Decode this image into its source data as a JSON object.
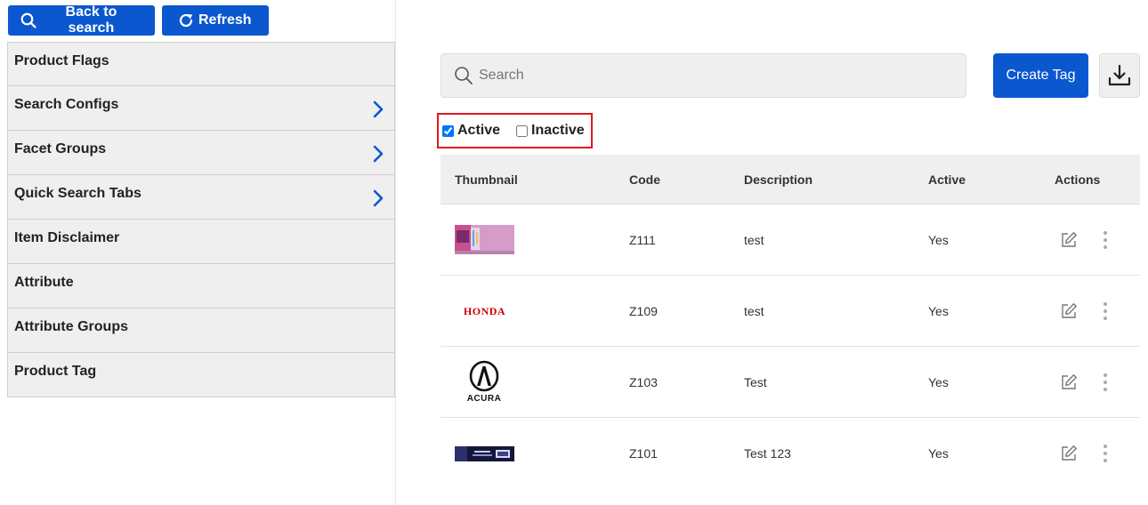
{
  "nav": {
    "back_label": "Back to search",
    "refresh_label": "Refresh"
  },
  "sidebar": {
    "items": [
      {
        "label": "Product Flags",
        "has_chevron": false
      },
      {
        "label": "Search Configs",
        "has_chevron": true
      },
      {
        "label": "Facet Groups",
        "has_chevron": true
      },
      {
        "label": "Quick Search Tabs",
        "has_chevron": true
      },
      {
        "label": "Item Disclaimer",
        "has_chevron": false
      },
      {
        "label": "Attribute",
        "has_chevron": false
      },
      {
        "label": "Attribute Groups",
        "has_chevron": false
      },
      {
        "label": "Product Tag",
        "has_chevron": false
      }
    ]
  },
  "search": {
    "placeholder": "Search"
  },
  "toolbar": {
    "create_label": "Create Tag"
  },
  "filters": {
    "active_label": "Active",
    "active_checked": true,
    "inactive_label": "Inactive",
    "inactive_checked": false
  },
  "table": {
    "headers": [
      "Thumbnail",
      "Code",
      "Description",
      "Active",
      "Actions"
    ],
    "rows": [
      {
        "thumbnail": "pink-banner-thumbnail",
        "code": "Z111",
        "description": "test",
        "active": "Yes"
      },
      {
        "thumbnail": "honda-logo-thumbnail",
        "thumbnail_text": "HONDA",
        "code": "Z109",
        "description": "test",
        "active": "Yes"
      },
      {
        "thumbnail": "acura-logo-thumbnail",
        "thumbnail_text": "ACURA",
        "code": "Z103",
        "description": "Test",
        "active": "Yes"
      },
      {
        "thumbnail": "dark-banner-thumbnail",
        "code": "Z101",
        "description": "Test 123",
        "active": "Yes"
      }
    ]
  },
  "colors": {
    "accent": "#0a57d0",
    "highlight_border": "#e0161d",
    "honda_red": "#cc0000"
  }
}
